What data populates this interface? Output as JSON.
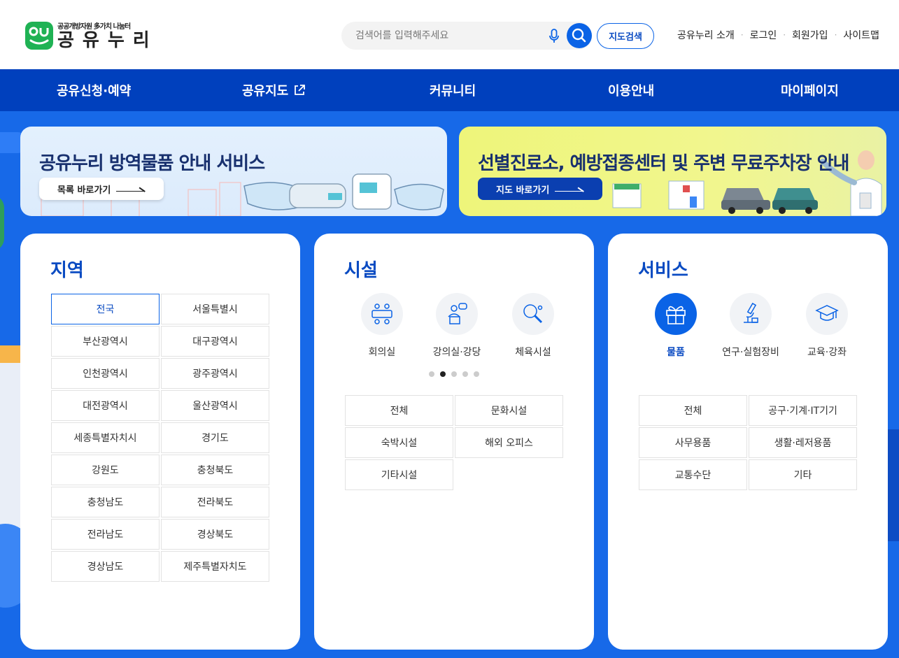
{
  "header": {
    "logo_sub": "공공개방자원 多가치 나눔터",
    "logo_main": "공유누리",
    "search_placeholder": "검색어를 입력해주세요",
    "map_search_label": "지도검색",
    "util_links": [
      "공유누리 소개",
      "로그인",
      "회원가입",
      "사이트맵"
    ]
  },
  "gnb": [
    "공유신청·예약",
    "공유지도",
    "커뮤니티",
    "이용안내",
    "마이페이지"
  ],
  "banners": [
    {
      "title": "공유누리 방역물품 안내 서비스",
      "button": "목록 바로가기"
    },
    {
      "title": "선별진료소, 예방접종센터 및 주변 무료주차장 안내",
      "button": "지도 바로가기"
    }
  ],
  "region": {
    "title": "지역",
    "items": [
      "전국",
      "서울특별시",
      "부산광역시",
      "대구광역시",
      "인천광역시",
      "광주광역시",
      "대전광역시",
      "울산광역시",
      "세종특별자치시",
      "경기도",
      "강원도",
      "충청북도",
      "충청남도",
      "전라북도",
      "전라남도",
      "경상북도",
      "경상남도",
      "제주특별자치도"
    ],
    "selected": "전국"
  },
  "facility": {
    "title": "시설",
    "icons": [
      "회의실",
      "강의실·강당",
      "체육시설"
    ],
    "pages": 5,
    "current_page": 2,
    "items": [
      "전체",
      "문화시설",
      "숙박시설",
      "해외 오피스",
      "기타시설"
    ]
  },
  "service": {
    "title": "서비스",
    "icons": [
      "물품",
      "연구·실험장비",
      "교육·강좌"
    ],
    "selected_icon": "물품",
    "items": [
      "전체",
      "공구·기계·IT기기",
      "사무용품",
      "생활·레저용품",
      "교통수단",
      "기타"
    ]
  },
  "colors": {
    "primary": "#0a63e6",
    "gnb": "#0040bd",
    "main_bg": "#1769e8",
    "logo_green": "#1fb254"
  }
}
